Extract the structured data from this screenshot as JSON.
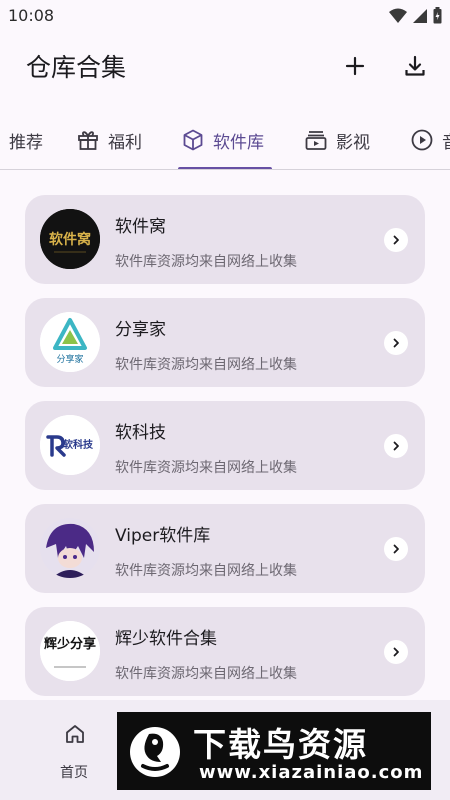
{
  "status_bar": {
    "time": "10:08"
  },
  "header": {
    "title": "仓库合集"
  },
  "tabs": [
    {
      "label": "推荐",
      "icon": "none"
    },
    {
      "label": "福利",
      "icon": "gift-icon"
    },
    {
      "label": "软件库",
      "icon": "cube-icon",
      "active": true
    },
    {
      "label": "影视",
      "icon": "tv-icon"
    },
    {
      "label": "音",
      "icon": "play-circle-icon"
    }
  ],
  "cards": [
    {
      "title": "软件窝",
      "subtitle": "软件库资源均来自网络上收集",
      "icon_text": "软件窝"
    },
    {
      "title": "分享家",
      "subtitle": "软件库资源均来自网络上收集",
      "icon_text": "分享家"
    },
    {
      "title": "软科技",
      "subtitle": "软件库资源均来自网络上收集",
      "icon_text": "软科技"
    },
    {
      "title": "Viper软件库",
      "subtitle": "软件库资源均来自网络上收集",
      "icon_text": ""
    },
    {
      "title": "辉少软件合集",
      "subtitle": "软件库资源均来自网络上收集",
      "icon_text": "辉少分享"
    }
  ],
  "bottom_nav": {
    "home_label": "首页"
  },
  "watermark": {
    "title": "下载鸟资源",
    "url": "www.xiazainiao.com"
  },
  "colors": {
    "accent": "#6750a4",
    "card_bg": "#e8e1ec",
    "page_bg": "#fcf8fd"
  }
}
